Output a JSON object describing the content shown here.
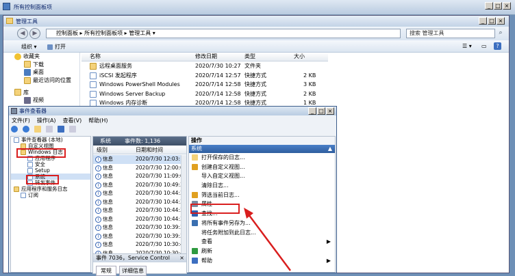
{
  "bg_window": {
    "title": "所有控制面板项"
  },
  "admin_window": {
    "title": "管理工具",
    "address": [
      "控制面板",
      "所有控制面板项",
      "管理工具"
    ],
    "search": "搜索 管理工具",
    "organize": "组织 ▾",
    "open": "打开",
    "nav": [
      "收藏夹",
      "下载",
      "桌面",
      "最近访问的位置",
      "库",
      "视频"
    ],
    "columns": [
      "名称",
      "修改日期",
      "类型",
      "大小"
    ],
    "files": [
      {
        "name": "远程桌面服务",
        "date": "2020/7/30 10:27",
        "type": "文件夹",
        "size": ""
      },
      {
        "name": "iSCSI 发起程序",
        "date": "2020/7/14 12:57",
        "type": "快捷方式",
        "size": "2 KB"
      },
      {
        "name": "Windows PowerShell Modules",
        "date": "2020/7/14 12:58",
        "type": "快捷方式",
        "size": "3 KB"
      },
      {
        "name": "Windows Server Backup",
        "date": "2020/7/14 12:58",
        "type": "快捷方式",
        "size": "2 KB"
      },
      {
        "name": "Windows 内存诊断",
        "date": "2020/7/14 12:58",
        "type": "快捷方式",
        "size": "1 KB"
      }
    ]
  },
  "event_viewer": {
    "title": "事件查看器",
    "menu": [
      "文件(F)",
      "操作(A)",
      "查看(V)",
      "帮助(H)"
    ],
    "tree": [
      "事件查看器 (本地)",
      "自定义视图",
      "Windows 日志",
      "应用程序",
      "安全",
      "Setup",
      "系统",
      "转发事件",
      "应用程序和服务日志",
      "订阅"
    ],
    "log_header": {
      "name": "系统",
      "count": "事件数: 1,136"
    },
    "columns": [
      "级别",
      "日期和时间"
    ],
    "events": [
      {
        "level": "信息",
        "time": "2020/7/30 12:03:"
      },
      {
        "level": "信息",
        "time": "2020/7/30 12:00:0"
      },
      {
        "level": "信息",
        "time": "2020/7/30 11:09:0"
      },
      {
        "level": "信息",
        "time": "2020/7/30 10:49:3"
      },
      {
        "level": "信息",
        "time": "2020/7/30 10:44:3"
      },
      {
        "level": "信息",
        "time": "2020/7/30 10:44:3"
      },
      {
        "level": "信息",
        "time": "2020/7/30 10:44:3"
      },
      {
        "level": "信息",
        "time": "2020/7/30 10:44:3"
      },
      {
        "level": "信息",
        "time": "2020/7/30 10:39:3"
      },
      {
        "level": "信息",
        "time": "2020/7/30 10:39:3"
      },
      {
        "level": "信息",
        "time": "2020/7/30 10:30:4"
      },
      {
        "level": "信息",
        "time": "2020/7/30 10:30:4"
      },
      {
        "level": "信息",
        "time": "2020/7/30 10:30:4"
      }
    ],
    "detail_title": "事件 7036，Service Control",
    "detail_tabs": [
      "常规",
      "详细信息"
    ],
    "actions_title": "操作",
    "actions_section": "系统",
    "actions": [
      "打开保存的日志...",
      "创建自定义视图...",
      "导入自定义视图...",
      "清除日志...",
      "筛选当前日志...",
      "属性",
      "查找...",
      "将所有事件另存为...",
      "将任务附加到此日志...",
      "查看",
      "刷新",
      "帮助"
    ]
  }
}
